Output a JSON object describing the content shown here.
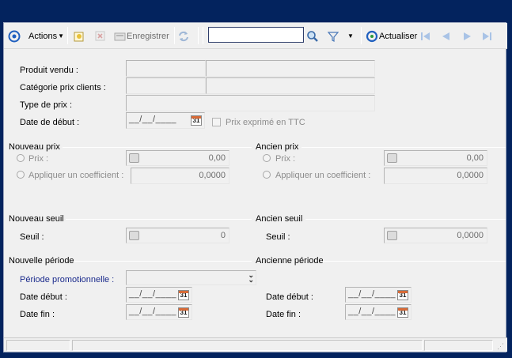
{
  "toolbar": {
    "actions_label": "Actions",
    "save_label": "Enregistrer",
    "search_value": "",
    "refresh_label": "Actualiser"
  },
  "fields": {
    "produit_vendu_label": "Produit vendu :",
    "categorie_label": "Catégorie prix clients :",
    "type_prix_label": "Type de prix :",
    "date_debut_label": "Date de début :",
    "date_debut_value": "__/__/____",
    "prix_ttc_label": "Prix exprimé en TTC"
  },
  "nouveau_prix": {
    "title": "Nouveau prix",
    "prix_label": "Prix :",
    "prix_value": "0,00",
    "coef_label": "Appliquer un coefficient :",
    "coef_value": "0,0000"
  },
  "ancien_prix": {
    "title": "Ancien prix",
    "prix_label": "Prix :",
    "prix_value": "0,00",
    "coef_label": "Appliquer un coefficient :",
    "coef_value": "0,0000"
  },
  "nouveau_seuil": {
    "title": "Nouveau seuil",
    "seuil_label": "Seuil :",
    "seuil_value": "0"
  },
  "ancien_seuil": {
    "title": "Ancien seuil",
    "seuil_label": "Seuil :",
    "seuil_value": "0,0000"
  },
  "nouvelle_periode": {
    "title": "Nouvelle période",
    "promo_label": "Période promotionnelle :",
    "promo_value": "",
    "date_debut_label": "Date début :",
    "date_debut_value": "__/__/____",
    "date_fin_label": "Date fin :",
    "date_fin_value": "__/__/____"
  },
  "ancienne_periode": {
    "title": "Ancienne période",
    "date_debut_label": "Date début :",
    "date_debut_value": "__/__/____",
    "date_fin_label": "Date fin :",
    "date_fin_value": "__/__/____"
  },
  "calendar_day": "31",
  "colors": {
    "background": "#03235e",
    "panel": "#f0f0f0",
    "link_label": "#1a2a8c",
    "accent_blue": "#1f5fbf"
  }
}
